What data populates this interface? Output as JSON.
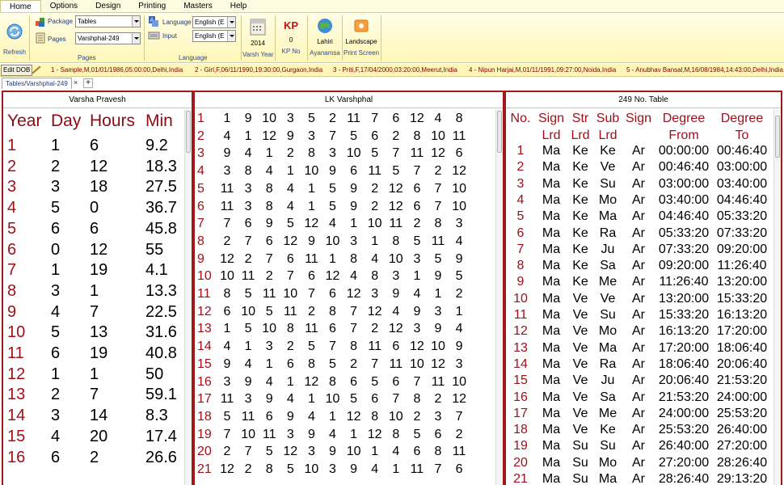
{
  "menu": {
    "tabs": [
      {
        "label": "Home",
        "active": true
      },
      {
        "label": "Options",
        "active": false
      },
      {
        "label": "Design",
        "active": false
      },
      {
        "label": "Printing",
        "active": false
      },
      {
        "label": "Masters",
        "active": false
      },
      {
        "label": "Help",
        "active": false
      }
    ]
  },
  "ribbon": {
    "refresh_label": "Refresh",
    "pages_group": {
      "package_label": "Package",
      "package_value": "Tables",
      "pages_label": "Pages",
      "pages_value": "Varshphal-249",
      "group_label": "Pages"
    },
    "language_group": {
      "language_label": "Language",
      "language_value": "English (E",
      "input_label": "Input",
      "input_value": "English (E",
      "group_label": "Language"
    },
    "varsh_year": {
      "value": "2014",
      "label": "Varsh Year"
    },
    "kp_no": {
      "icon_text": "KP",
      "value": "0",
      "label": "KP No"
    },
    "ayanamsa": {
      "value": "Lahiri",
      "label": "Ayanamsa"
    },
    "print_screen": {
      "value": "Landscape",
      "label": "Print Screen"
    }
  },
  "dob_bar": {
    "edit_label": "Edit DOB",
    "records": [
      "1 - Sample,M,01/01/1986,05:00:00,Delhi,India",
      "2 - Girl,F,06/11/1990,19:30:00,Gurgaon,India",
      "3 - Priti,F,17/04/2000,03:20:00,Meerut,India",
      "4 - Nipun Harjai,M,01/11/1991,09:27:00,Noida,India",
      "5 - Anubhav Bansal,M,16/08/1984,14:43:00,Delhi,India"
    ]
  },
  "doc_tab": {
    "label": "Tables/Varshphal-249",
    "close": "×",
    "add": "+"
  },
  "varsha_pravesh": {
    "title": "Varsha Pravesh",
    "headers": [
      "Year",
      "Day",
      "Hours",
      "Min"
    ],
    "rows": [
      [
        "1",
        "1",
        "6",
        "9.2"
      ],
      [
        "2",
        "2",
        "12",
        "18.3"
      ],
      [
        "3",
        "3",
        "18",
        "27.5"
      ],
      [
        "4",
        "5",
        "0",
        "36.7"
      ],
      [
        "5",
        "6",
        "6",
        "45.8"
      ],
      [
        "6",
        "0",
        "12",
        "55"
      ],
      [
        "7",
        "1",
        "19",
        "4.1"
      ],
      [
        "8",
        "3",
        "1",
        "13.3"
      ],
      [
        "9",
        "4",
        "7",
        "22.5"
      ],
      [
        "10",
        "5",
        "13",
        "31.6"
      ],
      [
        "11",
        "6",
        "19",
        "40.8"
      ],
      [
        "12",
        "1",
        "1",
        "50"
      ],
      [
        "13",
        "2",
        "7",
        "59.1"
      ],
      [
        "14",
        "3",
        "14",
        "8.3"
      ],
      [
        "15",
        "4",
        "20",
        "17.4"
      ],
      [
        "16",
        "6",
        "2",
        "26.6"
      ]
    ]
  },
  "lk_varshphal": {
    "title": "LK Varshphal",
    "rows": [
      [
        "1",
        "1",
        "9",
        "10",
        "3",
        "5",
        "2",
        "11",
        "7",
        "6",
        "12",
        "4",
        "8"
      ],
      [
        "2",
        "4",
        "1",
        "12",
        "9",
        "3",
        "7",
        "5",
        "6",
        "2",
        "8",
        "10",
        "11"
      ],
      [
        "3",
        "9",
        "4",
        "1",
        "2",
        "8",
        "3",
        "10",
        "5",
        "7",
        "11",
        "12",
        "6"
      ],
      [
        "4",
        "3",
        "8",
        "4",
        "1",
        "10",
        "9",
        "6",
        "11",
        "5",
        "7",
        "2",
        "12"
      ],
      [
        "5",
        "11",
        "3",
        "8",
        "4",
        "1",
        "5",
        "9",
        "2",
        "12",
        "6",
        "7",
        "10"
      ],
      [
        "6",
        "11",
        "3",
        "8",
        "4",
        "1",
        "5",
        "9",
        "2",
        "12",
        "6",
        "7",
        "10"
      ],
      [
        "7",
        "7",
        "6",
        "9",
        "5",
        "12",
        "4",
        "1",
        "10",
        "11",
        "2",
        "8",
        "3"
      ],
      [
        "8",
        "2",
        "7",
        "6",
        "12",
        "9",
        "10",
        "3",
        "1",
        "8",
        "5",
        "11",
        "4"
      ],
      [
        "9",
        "12",
        "2",
        "7",
        "6",
        "11",
        "1",
        "8",
        "4",
        "10",
        "3",
        "5",
        "9"
      ],
      [
        "10",
        "10",
        "11",
        "2",
        "7",
        "6",
        "12",
        "4",
        "8",
        "3",
        "1",
        "9",
        "5"
      ],
      [
        "11",
        "8",
        "5",
        "11",
        "10",
        "7",
        "6",
        "12",
        "3",
        "9",
        "4",
        "1",
        "2"
      ],
      [
        "12",
        "6",
        "10",
        "5",
        "11",
        "2",
        "8",
        "7",
        "12",
        "4",
        "9",
        "3",
        "1"
      ],
      [
        "13",
        "1",
        "5",
        "10",
        "8",
        "11",
        "6",
        "7",
        "2",
        "12",
        "3",
        "9",
        "4"
      ],
      [
        "14",
        "4",
        "1",
        "3",
        "2",
        "5",
        "7",
        "8",
        "11",
        "6",
        "12",
        "10",
        "9"
      ],
      [
        "15",
        "9",
        "4",
        "1",
        "6",
        "8",
        "5",
        "2",
        "7",
        "11",
        "10",
        "12",
        "3"
      ],
      [
        "16",
        "3",
        "9",
        "4",
        "1",
        "12",
        "8",
        "6",
        "5",
        "6",
        "7",
        "11",
        "10"
      ],
      [
        "17",
        "11",
        "3",
        "9",
        "4",
        "1",
        "10",
        "5",
        "6",
        "7",
        "8",
        "2",
        "12"
      ],
      [
        "18",
        "5",
        "11",
        "6",
        "9",
        "4",
        "1",
        "12",
        "8",
        "10",
        "2",
        "3",
        "7"
      ],
      [
        "19",
        "7",
        "10",
        "11",
        "3",
        "9",
        "4",
        "1",
        "12",
        "8",
        "5",
        "6",
        "2"
      ],
      [
        "20",
        "2",
        "7",
        "5",
        "12",
        "3",
        "9",
        "10",
        "1",
        "4",
        "6",
        "8",
        "11"
      ],
      [
        "21",
        "12",
        "2",
        "8",
        "5",
        "10",
        "3",
        "9",
        "4",
        "1",
        "11",
        "7",
        "6"
      ]
    ]
  },
  "table_249": {
    "title": "249 No. Table",
    "headers": [
      {
        "l1": "No.",
        "l2": ""
      },
      {
        "l1": "Sign",
        "l2": "Lrd"
      },
      {
        "l1": "Str",
        "l2": "Lrd"
      },
      {
        "l1": "Sub",
        "l2": "Lrd"
      },
      {
        "l1": "Sign",
        "l2": ""
      },
      {
        "l1": "Degree",
        "l2": "From"
      },
      {
        "l1": "Degree",
        "l2": "To"
      }
    ],
    "rows": [
      [
        "1",
        "Ma",
        "Ke",
        "Ke",
        "Ar",
        "00:00:00",
        "00:46:40"
      ],
      [
        "2",
        "Ma",
        "Ke",
        "Ve",
        "Ar",
        "00:46:40",
        "03:00:00"
      ],
      [
        "3",
        "Ma",
        "Ke",
        "Su",
        "Ar",
        "03:00:00",
        "03:40:00"
      ],
      [
        "4",
        "Ma",
        "Ke",
        "Mo",
        "Ar",
        "03:40:00",
        "04:46:40"
      ],
      [
        "5",
        "Ma",
        "Ke",
        "Ma",
        "Ar",
        "04:46:40",
        "05:33:20"
      ],
      [
        "6",
        "Ma",
        "Ke",
        "Ra",
        "Ar",
        "05:33:20",
        "07:33:20"
      ],
      [
        "7",
        "Ma",
        "Ke",
        "Ju",
        "Ar",
        "07:33:20",
        "09:20:00"
      ],
      [
        "8",
        "Ma",
        "Ke",
        "Sa",
        "Ar",
        "09:20:00",
        "11:26:40"
      ],
      [
        "9",
        "Ma",
        "Ke",
        "Me",
        "Ar",
        "11:26:40",
        "13:20:00"
      ],
      [
        "10",
        "Ma",
        "Ve",
        "Ve",
        "Ar",
        "13:20:00",
        "15:33:20"
      ],
      [
        "11",
        "Ma",
        "Ve",
        "Su",
        "Ar",
        "15:33:20",
        "16:13:20"
      ],
      [
        "12",
        "Ma",
        "Ve",
        "Mo",
        "Ar",
        "16:13:20",
        "17:20:00"
      ],
      [
        "13",
        "Ma",
        "Ve",
        "Ma",
        "Ar",
        "17:20:00",
        "18:06:40"
      ],
      [
        "14",
        "Ma",
        "Ve",
        "Ra",
        "Ar",
        "18:06:40",
        "20:06:40"
      ],
      [
        "15",
        "Ma",
        "Ve",
        "Ju",
        "Ar",
        "20:06:40",
        "21:53:20"
      ],
      [
        "16",
        "Ma",
        "Ve",
        "Sa",
        "Ar",
        "21:53:20",
        "24:00:00"
      ],
      [
        "17",
        "Ma",
        "Ve",
        "Me",
        "Ar",
        "24:00:00",
        "25:53:20"
      ],
      [
        "18",
        "Ma",
        "Ve",
        "Ke",
        "Ar",
        "25:53:20",
        "26:40:00"
      ],
      [
        "19",
        "Ma",
        "Su",
        "Su",
        "Ar",
        "26:40:00",
        "27:20:00"
      ],
      [
        "20",
        "Ma",
        "Su",
        "Mo",
        "Ar",
        "27:20:00",
        "28:26:40"
      ],
      [
        "21",
        "Ma",
        "Su",
        "Ma",
        "Ar",
        "28:26:40",
        "29:13:20"
      ]
    ]
  },
  "colors": {
    "accent_red": "#a0101a",
    "ribbon_bg": "#fff7b8",
    "label_blue": "#2e4b8a"
  },
  "icons": [
    "refresh-icon",
    "package-icon",
    "pages-icon",
    "language-icon",
    "input-icon",
    "calendar-icon",
    "kp-icon",
    "globe-icon",
    "landscape-icon",
    "pencil-icon"
  ]
}
